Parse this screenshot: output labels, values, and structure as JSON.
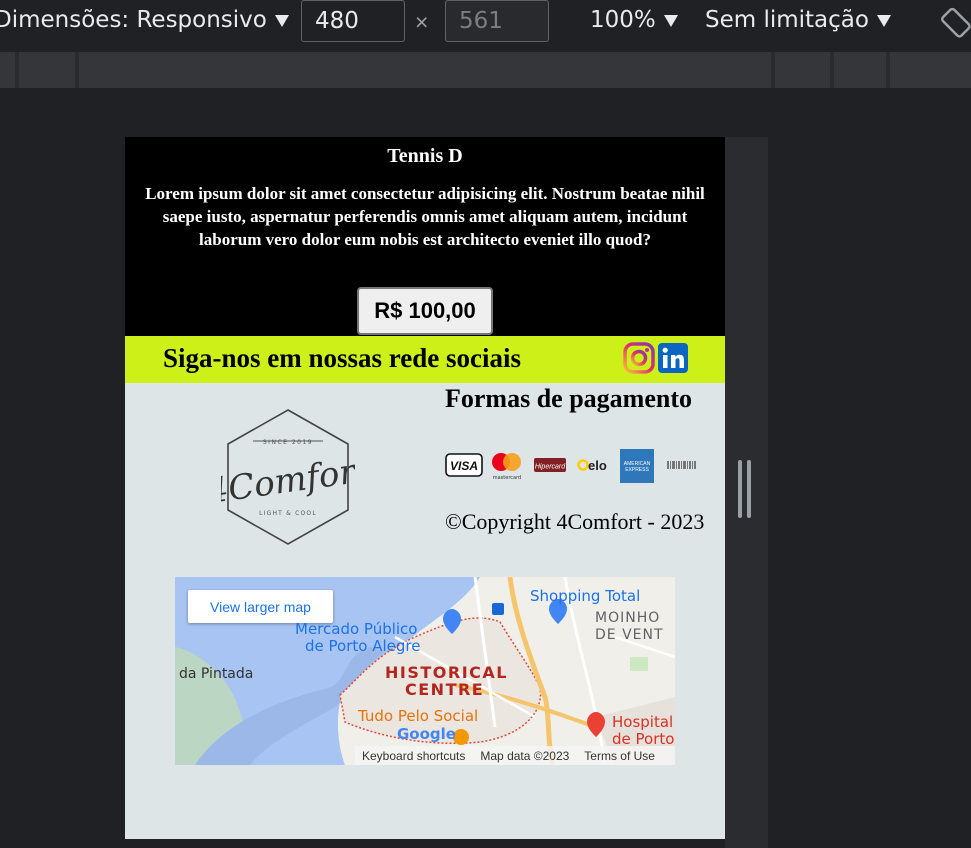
{
  "devtools": {
    "dimensions_label": "Dimensões: Responsivo",
    "width_value": "480",
    "height_placeholder": "561",
    "times_symbol": "×",
    "zoom_label": "100%",
    "throttle_label": "Sem limitação",
    "rotate_icon": "rotate-icon",
    "colors": {
      "toolbar_bg": "#202124",
      "text": "#e8eaed"
    }
  },
  "product": {
    "title": "Tennis D",
    "description": "Lorem ipsum dolor sit amet consectetur adipisicing elit. Nostrum beatae nihil saepe iusto, aspernatur perferendis omnis amet aliquam autem, incidunt laborum vero dolor eum nobis est architecto eveniet illo quod?",
    "price_label": "R$ 100,00"
  },
  "social": {
    "text": "Siga-nos em nossas rede sociais",
    "bg_color": "#cdf018",
    "icons": [
      "instagram-icon",
      "linkedin-icon"
    ]
  },
  "footer": {
    "logo": {
      "name": "4Comfort",
      "top_text": "SINCE 2019",
      "bottom_text": "LIGHT & COOL"
    },
    "payment_title": "Formas de pagamento",
    "payment_methods": [
      "VISA",
      "mastercard",
      "Hipercard",
      "elo",
      "AMERICAN EXPRESS",
      "boleto"
    ],
    "copyright": "©Copyright 4Comfort - 2023",
    "bg_color": "#dde5e6"
  },
  "map": {
    "view_larger_label": "View larger map",
    "places": [
      "Shopping Total",
      "MOINHO",
      "DE VENT",
      "Mercado Público",
      "de Porto Alegre",
      "da Pintada",
      "HISTORICAL",
      "CENTRE",
      "Tudo Pelo Social",
      "Hospital",
      "de Porto"
    ],
    "google_label": "Google",
    "footer_links": [
      "Keyboard shortcuts",
      "Map data ©2023",
      "Terms of Use"
    ]
  }
}
